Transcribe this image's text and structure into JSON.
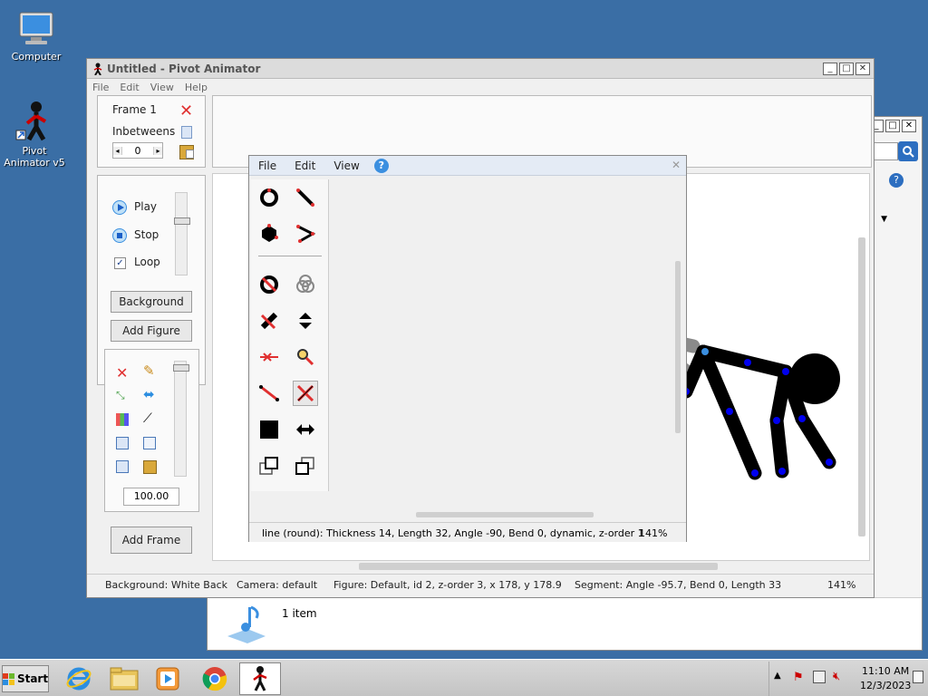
{
  "desktop": {
    "icons": [
      {
        "label": "Computer"
      },
      {
        "label": "Pivot Animator v5"
      }
    ]
  },
  "main_window": {
    "title": "Untitled - Pivot Animator",
    "menu": [
      "File",
      "Edit",
      "View",
      "Help"
    ],
    "frame_label": "Frame 1",
    "inbetweens_label": "Inbetweens",
    "inbetweens_value": "0",
    "play_label": "Play",
    "stop_label": "Stop",
    "loop_label": "Loop",
    "background_button": "Background",
    "add_figure_button": "Add Figure",
    "scale_value": "100.00",
    "add_frame_button": "Add Frame",
    "status": {
      "background": "Background: White Back",
      "camera": "Camera: default",
      "figure": "Figure: Default,  id 2,  z-order 3,  x 178, y 178.9",
      "segment": "Segment: Angle -95.7,  Bend 0,  Length 33",
      "zoom": "141%"
    }
  },
  "editor_window": {
    "menu": [
      "File",
      "Edit",
      "View"
    ],
    "status_text": "line (round): Thickness 14, Length 32, Angle -90, Bend 0, dynamic, z-order 1",
    "zoom": "141%"
  },
  "explorer_window": {
    "status_text": "1 item"
  },
  "taskbar": {
    "start_label": "Start",
    "time": "11:10 AM",
    "date": "12/3/2023"
  },
  "colors": {
    "desktop": "#3a6ea5",
    "joint_blue": "#0000ee",
    "joint_red": "#dd1111",
    "ghost_gray": "#8a8a8a"
  }
}
